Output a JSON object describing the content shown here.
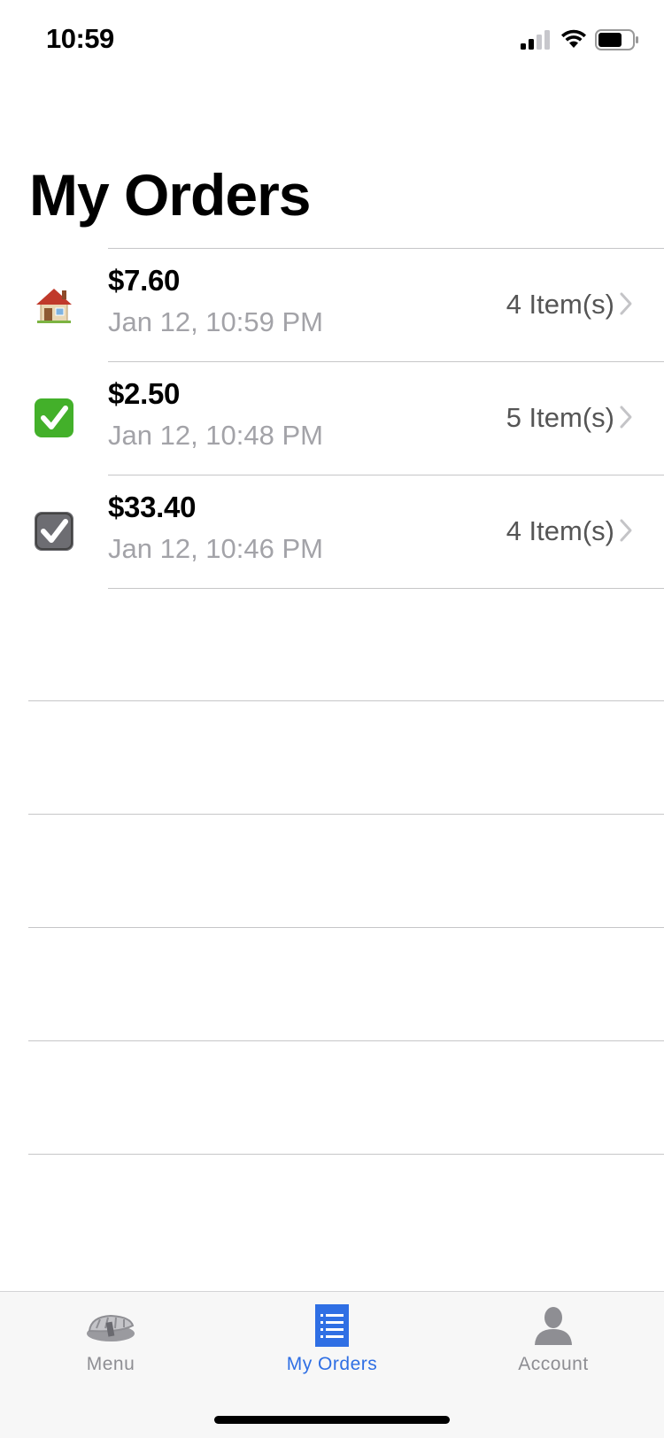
{
  "status_bar": {
    "time": "10:59",
    "icons": [
      "signal-icon",
      "wifi-icon",
      "battery-icon"
    ]
  },
  "title": "My Orders",
  "orders": [
    {
      "status_icon": "house-icon",
      "total": "$7.60",
      "date": "Jan 12, 10:59 PM",
      "items": "4 Item(s)"
    },
    {
      "status_icon": "green-check-icon",
      "total": "$2.50",
      "date": "Jan 12, 10:48 PM",
      "items": "5 Item(s)"
    },
    {
      "status_icon": "gray-check-icon",
      "total": "$33.40",
      "date": "Jan 12, 10:46 PM",
      "items": "4 Item(s)"
    }
  ],
  "tab_bar": {
    "tabs": [
      {
        "label": "Menu",
        "icon": "sushi-icon",
        "active": false
      },
      {
        "label": "My Orders",
        "icon": "list-icon",
        "active": true
      },
      {
        "label": "Account",
        "icon": "person-icon",
        "active": false
      }
    ]
  },
  "colors": {
    "accent": "#2f6fe4",
    "separator": "#c6c6c8",
    "secondary_text": "#a3a3a8",
    "tab_bar_bg": "#f7f7f7",
    "check_green": "#43b02a"
  }
}
